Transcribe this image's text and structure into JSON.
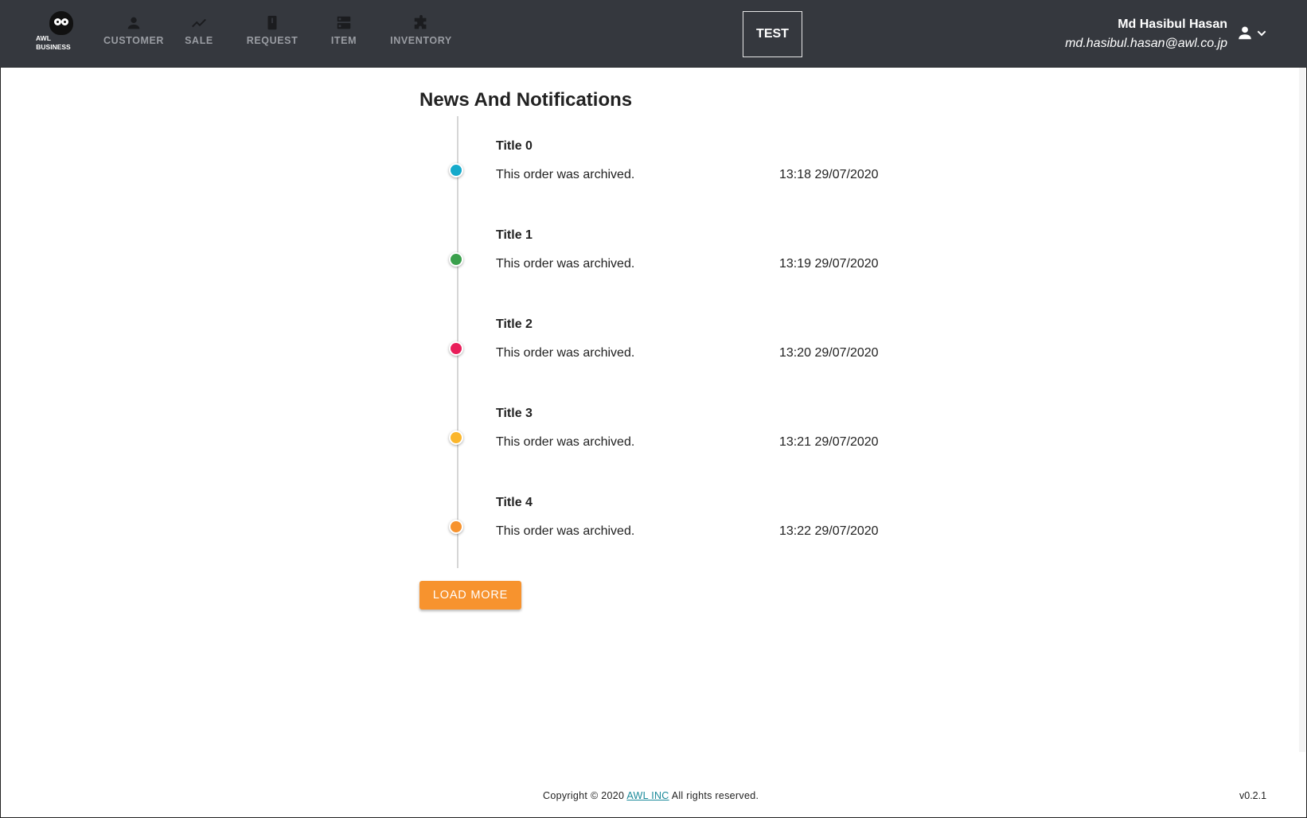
{
  "brand": {
    "line1": "AWL",
    "line2": "BUSINESS"
  },
  "nav": [
    {
      "label": "CUSTOMER",
      "icon": "person-icon"
    },
    {
      "label": "SALE",
      "icon": "trending-icon"
    },
    {
      "label": "REQUEST",
      "icon": "book-icon"
    },
    {
      "label": "ITEM",
      "icon": "storage-icon"
    },
    {
      "label": "INVENTORY",
      "icon": "puzzle-icon"
    }
  ],
  "env_button": "TEST",
  "user": {
    "name": "Md Hasibul Hasan",
    "email": "md.hasibul.hasan@awl.co.jp"
  },
  "page_title": "News And Notifications",
  "notifications": [
    {
      "title": "Title 0",
      "text": "This order was archived.",
      "time": "13:18 29/07/2020",
      "color": "#15aacb"
    },
    {
      "title": "Title 1",
      "text": "This order was archived.",
      "time": "13:19 29/07/2020",
      "color": "#3aa04c"
    },
    {
      "title": "Title 2",
      "text": "This order was archived.",
      "time": "13:20 29/07/2020",
      "color": "#e91e5a"
    },
    {
      "title": "Title 3",
      "text": "This order was archived.",
      "time": "13:21 29/07/2020",
      "color": "#fbb62c"
    },
    {
      "title": "Title 4",
      "text": "This order was archived.",
      "time": "13:22 29/07/2020",
      "color": "#f7932e"
    }
  ],
  "load_more": "LOAD MORE",
  "footer": {
    "prefix": "Copyright © 2020 ",
    "link": "AWL INC",
    "suffix": " All rights reserved.",
    "version": "v0.2.1"
  },
  "colors": {
    "header_bg": "#35383e",
    "accent": "#f7932e",
    "link": "#1a8a9a"
  }
}
